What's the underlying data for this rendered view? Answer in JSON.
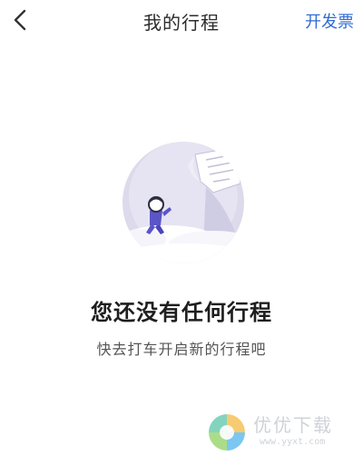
{
  "header": {
    "back_icon": "chevron-left-icon",
    "title": "我的行程",
    "invoice_label": "开发票"
  },
  "empty_state": {
    "illustration": "person-on-cloud-with-paper-illustration",
    "title": "您还没有任何行程",
    "subtitle": "快去打车开启新的行程吧"
  },
  "watermark": {
    "text": "优优下载",
    "url": "www.yyxt.com"
  },
  "colors": {
    "accent": "#2f6bd6",
    "title_text": "#2b2b2b",
    "illustration_bg": "#dcdaeb",
    "character": "#5b55c8"
  }
}
